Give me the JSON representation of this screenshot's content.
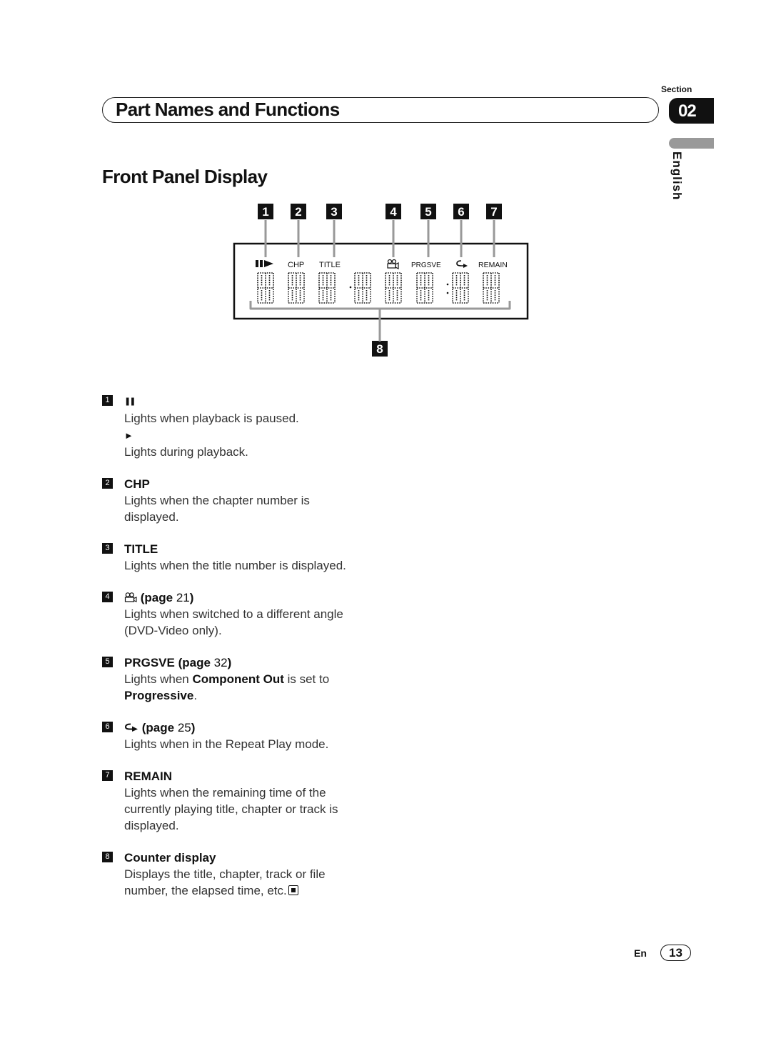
{
  "header": {
    "section_label": "Section",
    "section_number": "02",
    "title": "Part Names and Functions",
    "language": "English"
  },
  "page_heading": "Front Panel Display",
  "diagram": {
    "callouts": [
      "1",
      "2",
      "3",
      "4",
      "5",
      "6",
      "7",
      "8"
    ],
    "indicators": {
      "pause_play": "pause-play-icon",
      "chp": "CHP",
      "title": "TITLE",
      "angle": "angle-camera-icon",
      "prgsve": "PRGSVE",
      "repeat": "repeat-icon",
      "remain": "REMAIN"
    },
    "digit_count": 8
  },
  "items": [
    {
      "num": "1",
      "title_icon": "pause-icon",
      "title_glyph": "❚❚",
      "desc": "Lights when playback is paused.",
      "sub_icon": "play-icon",
      "sub_glyph": "►",
      "sub_desc": "Lights during playback."
    },
    {
      "num": "2",
      "title": "CHP",
      "desc": "Lights when the chapter number is displayed."
    },
    {
      "num": "3",
      "title": "TITLE",
      "desc": "Lights when the title number is displayed."
    },
    {
      "num": "4",
      "title_icon": "angle-icon",
      "page_word": "(page",
      "page_num": "21",
      "page_close": ")",
      "desc": "Lights when switched to a different angle (DVD-Video only)."
    },
    {
      "num": "5",
      "title": "PRGSVE",
      "page_word": "(page",
      "page_num": "32",
      "page_close": ")",
      "desc_pre": "Lights when ",
      "desc_b1": "Component Out",
      "desc_mid": " is set to ",
      "desc_b2": "Progressive",
      "desc_post": "."
    },
    {
      "num": "6",
      "title_icon": "repeat-icon",
      "page_word": "(page",
      "page_num": "25",
      "page_close": ")",
      "desc": "Lights when in the Repeat Play mode."
    },
    {
      "num": "7",
      "title": "REMAIN",
      "desc": "Lights when the remaining time of the currently playing title, chapter or track is displayed."
    },
    {
      "num": "8",
      "title": "Counter display",
      "desc": "Displays the title, chapter, track or file number, the elapsed time, etc."
    }
  ],
  "footer": {
    "language_code": "En",
    "page_number": "13"
  }
}
